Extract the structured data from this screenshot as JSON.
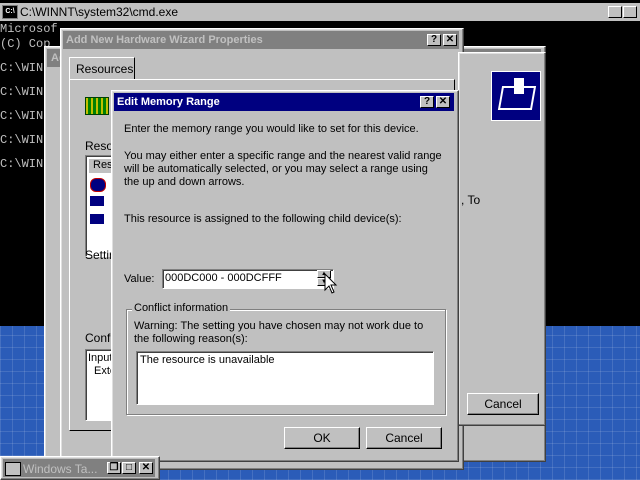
{
  "cmd": {
    "title": "C:\\WINNT\\system32\\cmd.exe",
    "lines": [
      "Microsof",
      "(C) Cop",
      "C:\\WINN",
      "C:\\WINN",
      "C:\\WINN",
      "C:\\WINN",
      "C:\\WINN"
    ]
  },
  "wizard_props": {
    "title": "Add New Hardware Wizard Properties",
    "tab_resources": "Resources",
    "label_resource": "Reso",
    "list_header": "Res",
    "settings_label": "Settin",
    "conflict_label": "Confli",
    "conflict_text1": "Input",
    "conflict_text2": "Exte",
    "side_text": ", To",
    "cancel_label": "Cancel"
  },
  "behind_window": {
    "title_fragment": "Ad"
  },
  "edit_memory": {
    "title": "Edit Memory Range",
    "instruction": "Enter the memory range you would like to set for this device.",
    "explain": "You may either enter a specific range and the nearest valid range will be automatically selected, or you may select a range using the up and down arrows.",
    "assigned": "This resource is assigned to the following child device(s):",
    "value_label": "Value:",
    "value": "000DC000 - 000DCFFF",
    "conflict_group": "Conflict information",
    "warning": "Warning: The setting you have chosen may not work due to the following reason(s):",
    "reason": "The resource is unavailable",
    "ok_label": "OK",
    "cancel_label": "Cancel"
  },
  "taskbar_item": {
    "label": "Windows Ta..."
  },
  "colors": {
    "titlebar_active": "#000080",
    "titlebar_inactive": "#808080",
    "face": "#c0c0c0",
    "desktop": "#2b5cb8"
  }
}
